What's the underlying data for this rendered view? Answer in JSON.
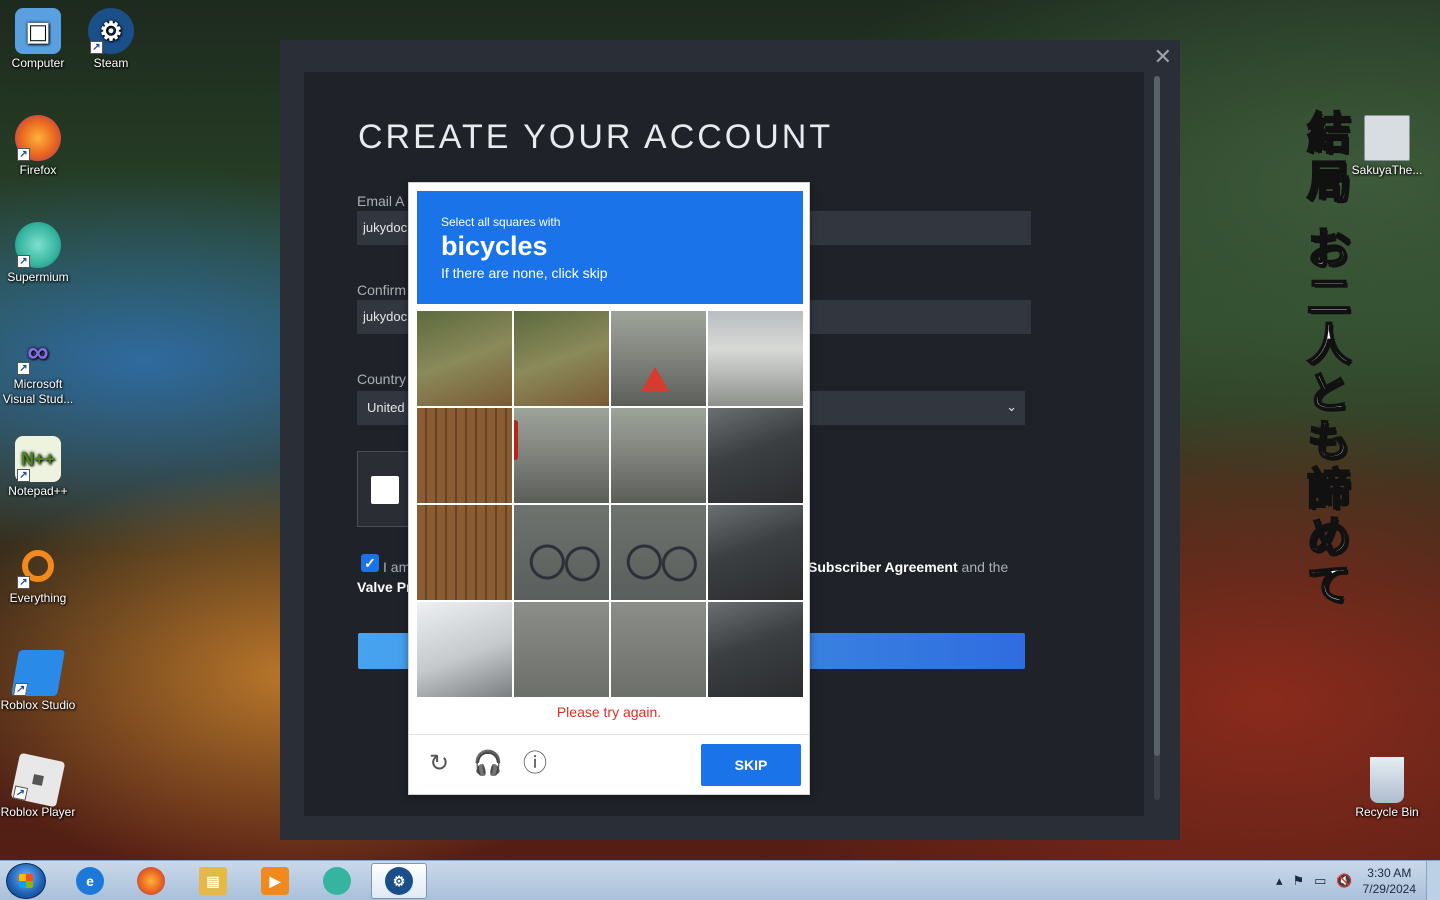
{
  "desktop": {
    "icons": [
      {
        "label": "Computer",
        "icon": "computer-icon",
        "color": "#5aa0e0"
      },
      {
        "label": "Steam",
        "icon": "steam-icon",
        "color": "#1b4f8a"
      },
      {
        "label": "Firefox",
        "icon": "firefox-icon",
        "color": "#e8641e"
      },
      {
        "label": "Supermium",
        "icon": "supermium-icon",
        "color": "#35b5a0"
      },
      {
        "label": "Microsoft Visual Stud...",
        "icon": "visual-studio-icon",
        "color": "#6b4bc8"
      },
      {
        "label": "Notepad++",
        "icon": "notepadpp-icon",
        "color": "#7dbb3a"
      },
      {
        "label": "Everything",
        "icon": "everything-icon",
        "color": "#f08a1c"
      },
      {
        "label": "Roblox Studio",
        "icon": "roblox-studio-icon",
        "color": "#2a8ae8"
      },
      {
        "label": "Roblox Player",
        "icon": "roblox-player-icon",
        "color": "#e8e8e8"
      },
      {
        "label": "SakuyaThe...",
        "icon": "file-icon",
        "color": "#d8dde2"
      },
      {
        "label": "Recycle Bin",
        "icon": "recycle-bin-icon",
        "color": "#c8d4e0"
      }
    ],
    "wallpaper_text": "結局 お二人とも諦めて"
  },
  "steam": {
    "title": "CREATE YOUR ACCOUNT",
    "close_glyph": "✕",
    "email_label": "Email A",
    "email_value": "jukydoc",
    "confirm_label": "Confirm",
    "confirm_value": "jukydoc",
    "country_label": "Country",
    "country_value": "United",
    "country_chevron": "⌄",
    "agree_left": "I am",
    "agree_right_prefix": "",
    "agree_ssa": "Subscriber Agreement",
    "agree_right_suffix": " and the",
    "agree_line2": "Valve Pr"
  },
  "captcha": {
    "prompt": "Select all squares with",
    "object": "bicycles",
    "subtext": "If there are none, click skip",
    "error": "Please try again.",
    "skip_label": "SKIP",
    "refresh_glyph": "↻",
    "audio_glyph": "🎧",
    "info_glyph": "ⓘ",
    "accent": "#1a73e8"
  },
  "taskbar": {
    "apps": [
      {
        "name": "internet-explorer",
        "glyph": "e",
        "color": "#1e78d8"
      },
      {
        "name": "firefox",
        "glyph": "ff",
        "color": "#e8641e"
      },
      {
        "name": "file-explorer",
        "glyph": "▤",
        "color": "#e6b84a"
      },
      {
        "name": "media-player",
        "glyph": "▶",
        "color": "#f08a1c"
      },
      {
        "name": "supermium",
        "glyph": "S",
        "color": "#35b5a0"
      },
      {
        "name": "steam",
        "glyph": "⚙",
        "color": "#1b4f8a"
      }
    ],
    "time": "3:30 AM",
    "date": "7/29/2024"
  }
}
